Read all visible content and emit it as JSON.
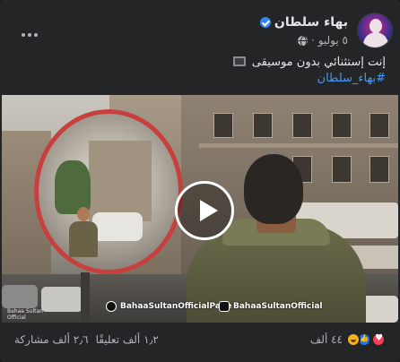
{
  "post": {
    "author_name": "بهاء سلطان",
    "date": "٥ يوليو",
    "date_separator": "·",
    "text_line": "إنت إستثنائي بدون موسيقى",
    "hashtag": "#بهاء_سلطان",
    "more_icon": "more-horizontal-icon",
    "verified_icon": "verified-badge-icon",
    "privacy_icon": "globe-icon"
  },
  "video": {
    "watermark_facebook": "BahaaSultanOfficialPage",
    "watermark_instagram": "BahaaSultanOfficial",
    "corner_watermark_line1": "Bahaa Sultan",
    "corner_watermark_line2": "Official"
  },
  "stats": {
    "reactions_count": "٤٤ ألف",
    "comments_count": "١٫٢ ألف تعليقًا",
    "shares_count": "٢٫٦ ألف مشاركة"
  },
  "colors": {
    "background": "#242526",
    "text_primary": "#e4e6eb",
    "text_secondary": "#b0b3b8",
    "link": "#4599ff",
    "verified": "#2d88ff",
    "love": "#f33e58",
    "like": "#1877f2",
    "haha": "#f7b125"
  }
}
